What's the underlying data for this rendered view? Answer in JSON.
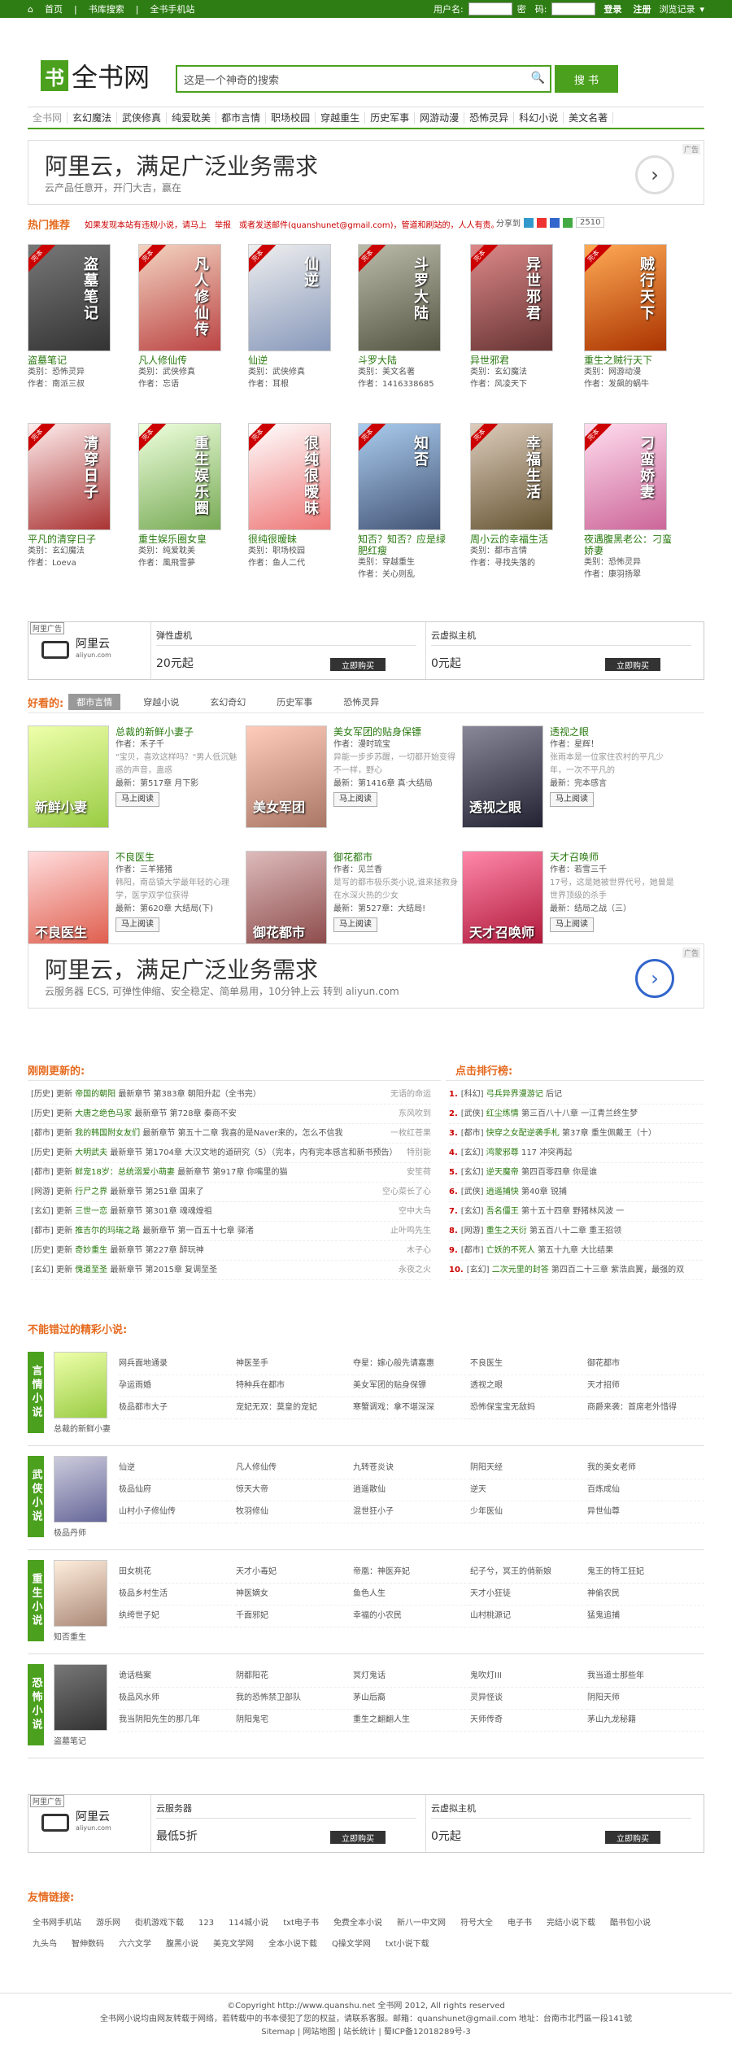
{
  "topbar": {
    "home": "首页",
    "shelf": "书库搜索",
    "mobile": "全书手机站",
    "user_label": "用户名:",
    "pass_label": "密　码:",
    "login": "登录",
    "register": "注册",
    "history": "浏览记录"
  },
  "logo": {
    "mark": "书",
    "text": "全书网"
  },
  "search": {
    "placeholder": "这是一个神奇的搜索",
    "button": "搜 书"
  },
  "nav": [
    "全书网",
    "玄幻魔法",
    "武侠修真",
    "纯爱耽美",
    "都市言情",
    "职场校园",
    "穿越重生",
    "历史军事",
    "网游动漫",
    "恐怖灵异",
    "科幻小说",
    "美文名著"
  ],
  "ad1": {
    "title": "阿里云，满足广泛业务需求",
    "sub": "云产品任意开，开门大吉，赢在",
    "tag": "广告"
  },
  "hot": {
    "heading": "热门推荐",
    "notice": "如果发现本站有违规小说，请马上　举报　或者发送邮件(quanshunet@gmail.com)，管道和刷站的，人人有责。",
    "share": "分享到",
    "count": "2510"
  },
  "hot_books": [
    {
      "title": "盗墓笔记",
      "cover_title": "盗墓笔记",
      "c1": "#333",
      "c2": "#777",
      "cat": "类别：恐怖灵异",
      "author": "作者：南派三叔"
    },
    {
      "title": "凡人修仙传",
      "cover_title": "凡人修仙传",
      "c1": "#b44",
      "c2": "#f3d3c0",
      "cat": "类别：武侠修真",
      "author": "作者：忘语"
    },
    {
      "title": "仙逆",
      "cover_title": "仙逆",
      "c1": "#89b",
      "c2": "#eee",
      "cat": "类别：武侠修真",
      "author": "作者：耳根"
    },
    {
      "title": "斗罗大陆",
      "cover_title": "斗罗大陆",
      "c1": "#554",
      "c2": "#bba",
      "cat": "类别：美文名著",
      "author": "作者：1416338685"
    },
    {
      "title": "异世邪君",
      "cover_title": "异世邪君",
      "c1": "#633",
      "c2": "#d88",
      "cat": "类别：玄幻魔法",
      "author": "作者：风凌天下"
    },
    {
      "title": "重生之贼行天下",
      "cover_title": "贼行天下",
      "c1": "#a30",
      "c2": "#fa5",
      "cat": "类别：网游动漫",
      "author": "作者：发飙的蜗牛"
    },
    {
      "title": "平凡的清穿日子",
      "cover_title": "清穿日子",
      "c1": "#a33",
      "c2": "#fee",
      "cat": "类别：玄幻魔法",
      "author": "作者：Loeva"
    },
    {
      "title": "重生娱乐圈女皇",
      "cover_title": "重生娱乐圈",
      "c1": "#7a5",
      "c2": "#efd",
      "cat": "类别：纯爱耽美",
      "author": "作者：風飛雪夢"
    },
    {
      "title": "很纯很暧昧",
      "cover_title": "很纯很暧昧",
      "c1": "#e77",
      "c2": "#fff",
      "cat": "类别：职场校园",
      "author": "作者：鱼人二代"
    },
    {
      "title": "知否？知否？应是绿肥红瘦",
      "cover_title": "知否",
      "c1": "#457",
      "c2": "#ace",
      "cat": "类别：穿越重生",
      "author": "作者：关心则乱"
    },
    {
      "title": "周小云的幸福生活",
      "cover_title": "幸福生活",
      "c1": "#653",
      "c2": "#dcb",
      "cat": "类别：都市言情",
      "author": "作者：寻找失落的"
    },
    {
      "title": "夜遇腹黑老公：刁蛮娇妻",
      "cover_title": "刁蛮娇妻",
      "c1": "#c69",
      "c2": "#fde",
      "cat": "类别：恐怖灵异",
      "author": "作者：康羽扬翠"
    }
  ],
  "adw1": {
    "label": "阿里广告",
    "brand": "阿里云",
    "brand_sub": "aliyun.com",
    "c1_h": "弹性虚机",
    "c1_p": "20元起",
    "c2_h": "云虚拟主机",
    "c2_p": "0元起",
    "buy": "立即购买"
  },
  "good": {
    "heading": "好看的:",
    "tabs": [
      "都市言情",
      "穿越小说",
      "玄幻奇幻",
      "历史军事",
      "恐怖灵异"
    ]
  },
  "good_books": [
    {
      "title": "总裁的新鲜小妻子",
      "cover_title": "新鲜小妻",
      "c1": "#9c4",
      "c2": "#efa",
      "author": "作者：禾子千",
      "desc": "\"宝贝，喜欢这样吗？\"男人低沉魅惑的声音，蛊惑",
      "latest": "最新：第517章 月下影",
      "btn": "马上阅读"
    },
    {
      "title": "美女军团的贴身保镖",
      "cover_title": "美女军团",
      "c1": "#a76",
      "c2": "#fcb",
      "author": "作者：漫时琉宝",
      "desc": "异能一步步苏醒，一切都开始变得不一样，野心",
      "latest": "最新：第1416章 真·大结局",
      "btn": "马上阅读"
    },
    {
      "title": "透视之眼",
      "cover_title": "透视之眼",
      "c1": "#223",
      "c2": "#889",
      "author": "作者：星辉！",
      "desc": "张雨本是一位家住农村的平凡少年，一次不平凡的",
      "latest": "最新：完本感言",
      "btn": "马上阅读"
    },
    {
      "title": "不良医生",
      "cover_title": "不良医生",
      "c1": "#d54",
      "c2": "#fdd",
      "author": "作者：三羊猪猪",
      "desc": "韩阳，南岳镇大学最年轻的心理学，医学双学位获得",
      "latest": "最新：第620章 大结局(下)",
      "btn": "马上阅读"
    },
    {
      "title": "御花都市",
      "cover_title": "御花都市",
      "c1": "#844",
      "c2": "#dbb",
      "author": "作者：见兰香",
      "desc": "是写的都市极乐类小说,谁来拯救身在水深火热的少女",
      "latest": "最新：第527章：大结局!",
      "btn": "马上阅读"
    },
    {
      "title": "天才召唤师",
      "cover_title": "天才召唤师",
      "c1": "#a13",
      "c2": "#f8a",
      "author": "作者：若雪三千",
      "desc": "17号，这是她被世界代号，她曾是世界顶级的杀手",
      "latest": "最新：结局之战（三）",
      "btn": "马上阅读"
    }
  ],
  "ad2": {
    "title": "阿里云，满足广泛业务需求",
    "sub": "云服务器 ECS, 可弹性伸缩、安全稳定、简单易用，10分钟上云 转到 aliyun.com",
    "tag": "广告"
  },
  "updates": {
    "heading": "刚刚更新的:",
    "rows": [
      {
        "cat": "[历史]",
        "book": "帝国的朝阳",
        "ch": "最新章节 第383章 朝阳升起（全书完）",
        "auth": "无语的命运"
      },
      {
        "cat": "[历史]",
        "book": "大唐之绝色马家",
        "ch": "最新章节 第728章 秦商不安",
        "auth": "东风吹到"
      },
      {
        "cat": "[都市]",
        "book": "我的韩国附女友们",
        "ch": "最新章节 第五十二章 我喜的是Naver来的，怎么不信我",
        "auth": "一枚红苍果"
      },
      {
        "cat": "[历史]",
        "book": "大明武夫",
        "ch": "最新章节 第1704章 大汉文地的道研究（5）（完本，内有完本感言和新书预告）",
        "auth": "特别能"
      },
      {
        "cat": "[都市]",
        "book": "鲜宠18岁：总统溺爱小萌妻",
        "ch": "最新章节 第917章 你嘴里的猫",
        "auth": "安笙荷"
      },
      {
        "cat": "[网游]",
        "book": "行尸之界",
        "ch": "最新章节 第251章 国来了",
        "auth": "空心菜长了心"
      },
      {
        "cat": "[玄幻]",
        "book": "三世一恋",
        "ch": "最新章节 第301章 魂魂煌祖",
        "auth": "空中大鸟"
      },
      {
        "cat": "[都市]",
        "book": "推吉尔的玛瑞之路",
        "ch": "最新章节 第一百五十七章 驿渚",
        "auth": "止叶鸣先生"
      },
      {
        "cat": "[历史]",
        "book": "奇妙重生",
        "ch": "最新章节 第227章 醉玩神",
        "auth": "木子心"
      },
      {
        "cat": "[玄幻]",
        "book": "傀道至圣",
        "ch": "最新章节 第2015章 复调至圣",
        "auth": "永夜之火"
      }
    ]
  },
  "ranking": {
    "heading": "点击排行榜:",
    "rows": [
      {
        "n": "1.",
        "cat": "[科幻]",
        "book": "弓兵异界漫游记",
        "ch": "后记"
      },
      {
        "n": "2.",
        "cat": "[武侠]",
        "book": "红尘练情",
        "ch": "第三百八十八章 一江青兰终生梦"
      },
      {
        "n": "3.",
        "cat": "[都市]",
        "book": "快穿之女配逆袭手札",
        "ch": "第37章 重生佩戴王（十）"
      },
      {
        "n": "4.",
        "cat": "[玄幻]",
        "book": "鸿蒙邪尊",
        "ch": "117 冲突再起"
      },
      {
        "n": "5.",
        "cat": "[玄幻]",
        "book": "逆天魔帝",
        "ch": "第四百零四章 你是谁"
      },
      {
        "n": "6.",
        "cat": "[武侠]",
        "book": "逍遥捕快",
        "ch": "第40章 锐捕"
      },
      {
        "n": "7.",
        "cat": "[玄幻]",
        "book": "吾名僵王",
        "ch": "第十五十四章 野猪林风波 一"
      },
      {
        "n": "8.",
        "cat": "[网游]",
        "book": "重生之天衍",
        "ch": "第五百八十二章 重王招领"
      },
      {
        "n": "9.",
        "cat": "[都市]",
        "book": "亡妖的不死人",
        "ch": "第五十九章 大比结果"
      },
      {
        "n": "10.",
        "cat": "[玄幻]",
        "book": "二次元里的封答",
        "ch": "第四百二十三章 紫浩启翼，最强的双"
      }
    ]
  },
  "categories": {
    "heading": "不能错过的精彩小说:",
    "groups": [
      {
        "label": "言情小说",
        "book": "总裁的新鲜小妻",
        "c1": "#9c4",
        "c2": "#efa",
        "items": [
          "网兵面地通录",
          "神医圣手",
          "夺星：嫁心般先请嘉惠",
          "不良医生",
          "御花都市",
          "孕运雨婚",
          "特种兵在都市",
          "美女军团的贴身保镖",
          "透视之眼",
          "天才招师",
          "极品都市大子",
          "宠妃无双：莫皇的宠妃",
          "寒蟹调戏：拿不堪深深",
          "恐怖保宝宝无敌妈",
          "商爵来袭：首席老外惜得"
        ]
      },
      {
        "label": "武侠小说",
        "book": "极品丹师",
        "c1": "#669",
        "c2": "#ccd",
        "items": [
          "仙逆",
          "凡人修仙传",
          "九转苍炎诀",
          "阴阳天经",
          "我的美女老师",
          "极品仙府",
          "惊天大帝",
          "逍遥散仙",
          "逆天",
          "百炼成仙",
          "山村小子修仙传",
          "牧羽修仙",
          "混世狂小子",
          "少年医仙",
          "异世仙尊"
        ]
      },
      {
        "label": "重生小说",
        "book": "知否重生",
        "c1": "#a87",
        "c2": "#fed",
        "items": [
          "田女桃花",
          "天才小毒妃",
          "帝凰：神医弃妃",
          "纪子兮，冥王的俏新娘",
          "鬼王的特工狂妃",
          "极品乡村生活",
          "神医嫡女",
          "鱼色人生",
          "天才小狂徒",
          "神偷农民",
          "纨绔世子妃",
          "千面邪妃",
          "幸福的小农民",
          "山村桃源记",
          "猛鬼追捕"
        ]
      },
      {
        "label": "恐怖小说",
        "book": "盗墓笔记",
        "c1": "#333",
        "c2": "#777",
        "items": [
          "诡话档案",
          "阴都阳花",
          "冥灯鬼话",
          "鬼吹灯III",
          "我当道士那些年",
          "极品风水师",
          "我的恐怖禁卫部队",
          "茅山后裔",
          "灵异怪谈",
          "阴阳天师",
          "我当阴阳先生的那几年",
          "阴阳鬼宅",
          "重生之翻翻人生",
          "天师传奇",
          "茅山九龙秘籍"
        ]
      }
    ]
  },
  "adw2": {
    "label": "阿里广告",
    "brand": "阿里云",
    "brand_sub": "aliyun.com",
    "c1_h": "云服务器",
    "c1_p": "最低5折",
    "c2_h": "云虚拟主机",
    "c2_p": "0元起",
    "buy": "立即购买"
  },
  "friend_links": {
    "heading": "友情链接:",
    "items": [
      "全书网手机站",
      "游乐网",
      "街机游戏下载",
      "123",
      "114城小说",
      "txt电子书",
      "免费全本小说",
      "新八一中文网",
      "符号大全",
      "电子书",
      "完结小说下载",
      "酷书包小说",
      "九头鸟",
      "智伸数码",
      "六六文学",
      "腹黑小说",
      "美克文学网",
      "全本小说下载",
      "Q操文学网",
      "txt小说下载"
    ]
  },
  "footer": {
    "line1": "©Copyright http://www.quanshu.net 全书网 2012, All rights reserved",
    "line2": "全书网小说均由网友转载于网络，若转载中的书本侵犯了您的权益，请联系客服。邮箱：quanshunet@gmail.com 地址：台南市北門區一段141號",
    "line3": "Sitemap | 网站地图 | 站长统计 | 蜀ICP备12018289号-3"
  }
}
